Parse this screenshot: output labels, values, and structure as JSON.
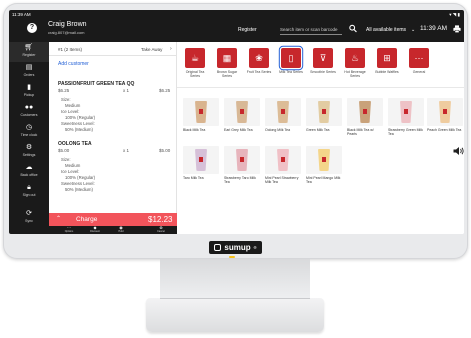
{
  "status_bar": {
    "time": "11:39 AM",
    "icons": "▾ ◥ ▮"
  },
  "header": {
    "user_name": "Craig Brown",
    "user_email": "craig.807@mail.com",
    "register_label": "Register",
    "search_placeholder": "Search item or scan barcode",
    "filter_label": "All available items",
    "clock": "11:39 AM"
  },
  "nav": [
    {
      "label": "Register",
      "icon": "cart-icon"
    },
    {
      "label": "Orders",
      "icon": "orders-icon"
    },
    {
      "label": "Pickup",
      "icon": "pickup-icon"
    },
    {
      "label": "Customers",
      "icon": "customers-icon"
    },
    {
      "label": "Time clock",
      "icon": "clock-icon"
    },
    {
      "label": "Settings",
      "icon": "gear-icon"
    },
    {
      "label": "Back office",
      "icon": "cloud-icon"
    },
    {
      "label": "Sign out",
      "icon": "lock-icon"
    },
    {
      "label": "Sync",
      "icon": "sync-icon"
    }
  ],
  "cart": {
    "count_label": "#1 (2 Items)",
    "order_type": "Take Away",
    "add_customer": "Add customer",
    "lines": [
      {
        "name": "PASSIONFRUIT GREEN TEA QQ",
        "unit_price": "$6.25",
        "qty": "x 1",
        "total": "$6.25",
        "modifiers": [
          "Size:",
          "Medium",
          "Ice Level:",
          "100% (Regular)",
          "Sweetness Level:",
          "50% (Medium)"
        ]
      },
      {
        "name": "OOLONG TEA",
        "unit_price": "$5.00",
        "qty": "x 1",
        "total": "$5.00",
        "modifiers": [
          "Size:",
          "Medium",
          "Ice Level:",
          "100% (Regular)",
          "Sweetness Level:",
          "50% (Medium)"
        ]
      }
    ],
    "charge_label": "Charge",
    "charge_amount": "$12.23",
    "footer": [
      {
        "label": "Options",
        "icon": "options-icon"
      },
      {
        "label": "Discount",
        "icon": "discount-icon"
      },
      {
        "label": "Hold",
        "icon": "hold-icon"
      },
      {
        "label": "Cancel",
        "icon": "cancel-icon"
      }
    ]
  },
  "categories": [
    {
      "label": "Original Tea Series",
      "icon": "tea-pot-icon",
      "selected": false
    },
    {
      "label": "Brown Sugar Series",
      "icon": "sugar-icon",
      "selected": false
    },
    {
      "label": "Fruit Tea Series",
      "icon": "fruit-icon",
      "selected": false
    },
    {
      "label": "Milk Tea Series",
      "icon": "milk-tea-icon",
      "selected": true
    },
    {
      "label": "Smoothie Series",
      "icon": "smoothie-icon",
      "selected": false
    },
    {
      "label": "Hot Beverage Series",
      "icon": "hot-cup-icon",
      "selected": false
    },
    {
      "label": "Bubble Waffles",
      "icon": "waffle-icon",
      "selected": false
    },
    {
      "label": "General",
      "icon": "more-icon",
      "selected": false
    }
  ],
  "products": [
    {
      "label": "Black Milk Tea",
      "color": "#d9b48f"
    },
    {
      "label": "Earl Grey Milk Tea",
      "color": "#d8b896"
    },
    {
      "label": "Oolong Milk Tea",
      "color": "#dcbc97"
    },
    {
      "label": "Green Milk Tea",
      "color": "#e2cca2"
    },
    {
      "label": "Black Milk Tea w/ Pearls",
      "color": "#c9a27a"
    },
    {
      "label": "Strawberry Green Milk Tea",
      "color": "#eec2c6"
    },
    {
      "label": "Peach Green Milk Tea",
      "color": "#efcc9f"
    },
    {
      "label": "Taro Milk Tea",
      "color": "#d6c0d8"
    },
    {
      "label": "Strawberry Taro Milk Tea",
      "color": "#e7b4bc"
    },
    {
      "label": "Mini Pearl Strawberry Milk Tea",
      "color": "#f0c0c6"
    },
    {
      "label": "Mini Pearl Mango Milk Tea",
      "color": "#f4d58a"
    }
  ],
  "brand": {
    "name": "sumup",
    "mark": "®"
  },
  "colors": {
    "accent": "#f2545b",
    "category": "#c7272c",
    "dark": "#1a1a1a",
    "link": "#2461d6"
  }
}
